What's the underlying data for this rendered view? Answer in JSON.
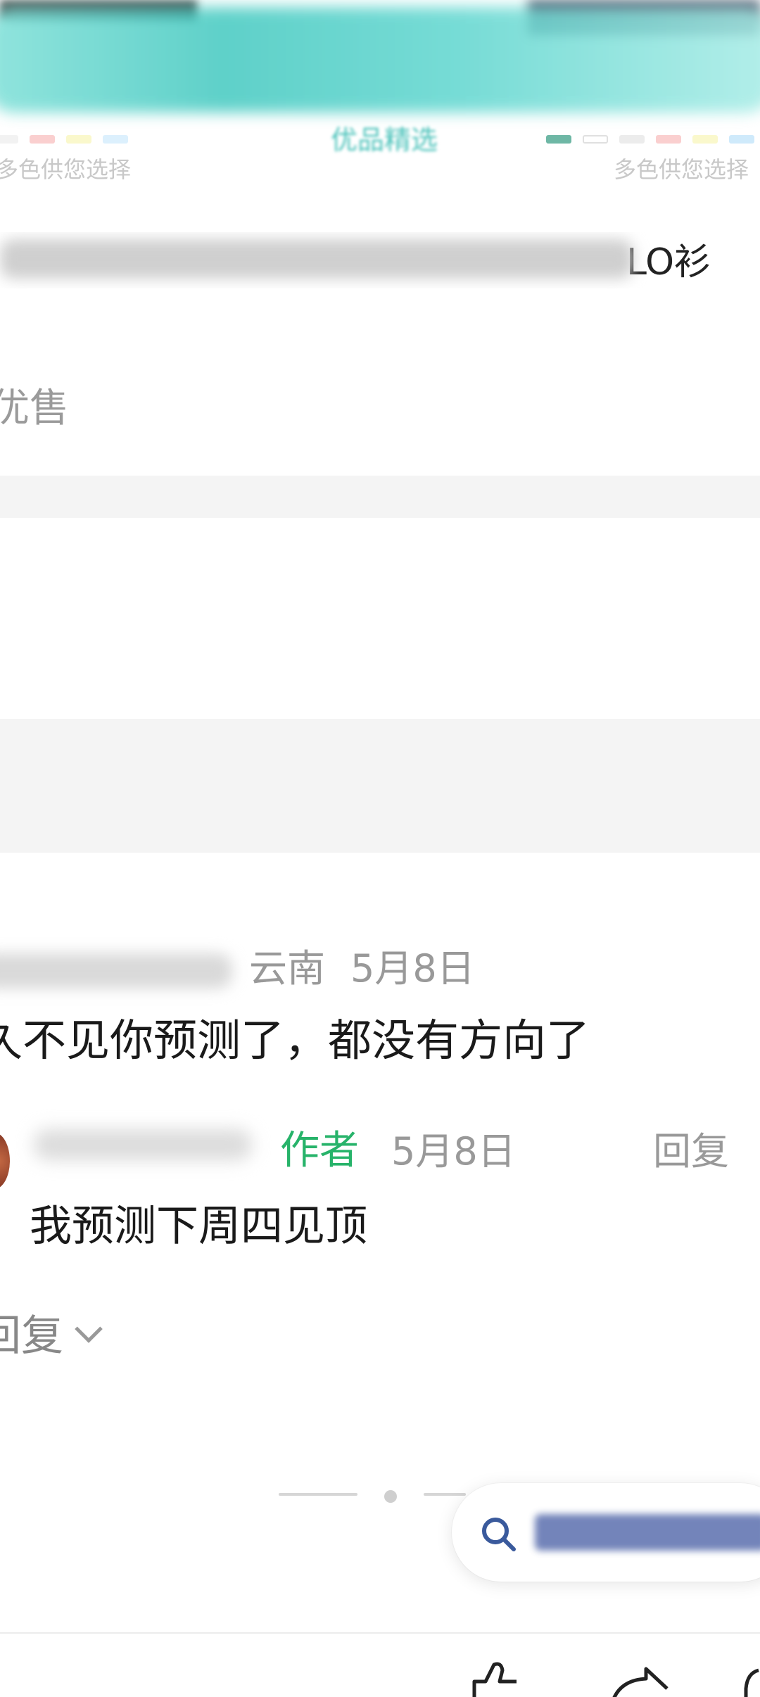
{
  "ad_banner": {
    "headline": "",
    "subtitle": "优品精选",
    "color_note_left": "多色供您选择",
    "color_note_right": "多色供您选择",
    "swatch_colors": [
      "#e8e8e8",
      "#f6a7a7",
      "#f6f2a3",
      "#bfe3fb",
      "#4aa58f",
      "#ffffff",
      "#dcdcdc",
      "#f6a7a7",
      "#f6f2a3",
      "#a8d8f8"
    ]
  },
  "product": {
    "title_visible_suffix": "LO衫",
    "tag": "优售"
  },
  "comment": {
    "location": "云南",
    "date": "5月8日",
    "body": "久不见你预测了，都没有方向了",
    "reply": {
      "author_badge": "作者",
      "date": "5月8日",
      "reply_label": "回复",
      "body": "我预测下周四见顶"
    },
    "expand_label": "回复"
  },
  "search": {
    "icon": "search-icon"
  },
  "toolbar": {
    "icons": [
      "like-icon",
      "share-icon",
      "comment-icon"
    ]
  },
  "colors": {
    "author_green": "#27b36a",
    "muted_text": "#999999",
    "banner_teal": "#43c9c0"
  }
}
